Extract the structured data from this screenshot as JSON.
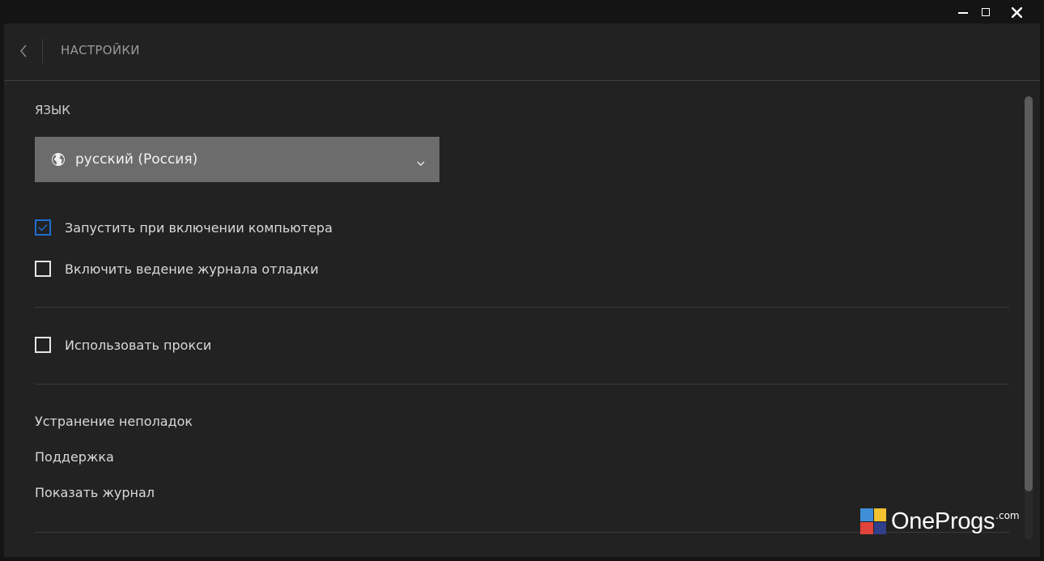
{
  "window": {
    "minimize_label": "",
    "maximize_label": "",
    "close_label": ""
  },
  "header": {
    "title": "НАСТРОЙКИ"
  },
  "language": {
    "section_label": "ЯЗЫК",
    "selected": "русский (Россия)"
  },
  "options": {
    "autostart": {
      "label": "Запустить при включении компьютера",
      "checked": true
    },
    "debug_log": {
      "label": "Включить ведение журнала отладки",
      "checked": false
    },
    "proxy": {
      "label": "Использовать прокси",
      "checked": false
    }
  },
  "links": {
    "troubleshoot": "Устранение неполадок",
    "support": "Поддержка",
    "show_log": "Показать журнал"
  },
  "scroll": {
    "position": 0.0,
    "visible_fraction": 0.89
  },
  "watermark": {
    "brand": "OneProgs",
    "suffix": ".com"
  },
  "colors": {
    "accent": "#1f6fd1",
    "background": "#222222",
    "dropdown": "#6b6c6b"
  }
}
